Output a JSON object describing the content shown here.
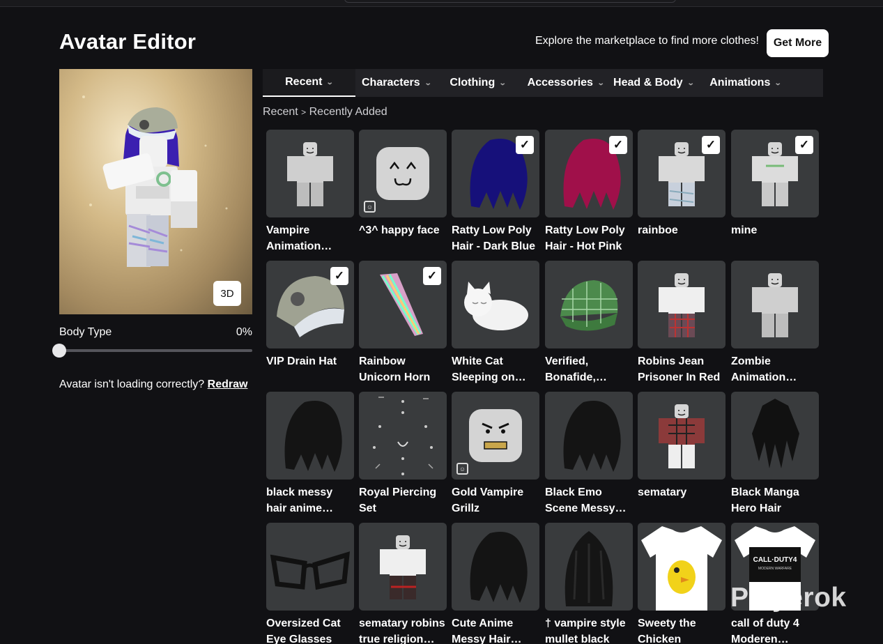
{
  "header": {
    "title": "Avatar Editor",
    "explore_text": "Explore the marketplace to find more clothes!",
    "get_more_label": "Get More"
  },
  "preview": {
    "view_toggle_label": "3D",
    "body_type_label": "Body Type",
    "body_type_value": "0%",
    "body_type_fraction": 0,
    "loading_text": "Avatar isn't loading correctly?",
    "redraw_label": "Redraw"
  },
  "tabs": [
    {
      "label": "Recent",
      "active": true
    },
    {
      "label": "Characters"
    },
    {
      "label": "Clothing"
    },
    {
      "label": "Accessories"
    },
    {
      "label": "Head & Body"
    },
    {
      "label": "Animations"
    }
  ],
  "breadcrumb": {
    "root": "Recent",
    "separator": ">",
    "current": "Recently Added"
  },
  "items": [
    {
      "name": "Vampire Animation…",
      "thumb": "figure-grey",
      "checked": false
    },
    {
      "name": "^3^ happy face",
      "thumb": "face-happy",
      "checked": false,
      "badge": "face-icon"
    },
    {
      "name": "Ratty Low Poly Hair - Dark Blue",
      "thumb": "hair-blue",
      "checked": true
    },
    {
      "name": "Ratty Low Poly Hair - Hot Pink",
      "thumb": "hair-pink",
      "checked": true
    },
    {
      "name": "rainboe",
      "thumb": "figure-pants",
      "checked": true
    },
    {
      "name": "mine",
      "thumb": "figure-shirt",
      "checked": true
    },
    {
      "name": "VIP Drain Hat",
      "thumb": "cap",
      "checked": true
    },
    {
      "name": "Rainbow Unicorn Horn",
      "thumb": "horn",
      "checked": true
    },
    {
      "name": "White Cat Sleeping on Lef…",
      "thumb": "cat",
      "checked": false
    },
    {
      "name": "Verified, Bonafide,…",
      "thumb": "green-cap",
      "checked": false
    },
    {
      "name": "Robins Jean Prisoner In Red",
      "thumb": "figure-plaid",
      "checked": false
    },
    {
      "name": "Zombie Animation…",
      "thumb": "figure-grey",
      "checked": false
    },
    {
      "name": "black messy hair anime season 10",
      "thumb": "hair-black",
      "checked": false
    },
    {
      "name": "Royal Piercing Set",
      "thumb": "piercings",
      "checked": false
    },
    {
      "name": "Gold Vampire Grillz",
      "thumb": "face-angry",
      "checked": false,
      "badge": "face-icon"
    },
    {
      "name": "Black Emo Scene Messy…",
      "thumb": "hair-black",
      "checked": false
    },
    {
      "name": "sematary",
      "thumb": "figure-redshirt",
      "checked": false
    },
    {
      "name": "Black Manga Hero Hair",
      "thumb": "hair-spiky",
      "checked": false
    },
    {
      "name": "Oversized Cat Eye Glasses",
      "thumb": "glasses",
      "checked": false
    },
    {
      "name": "sematary robins true religion…",
      "thumb": "figure-darkpants",
      "checked": false
    },
    {
      "name": "Cute Anime Messy Hair…",
      "thumb": "hair-black",
      "checked": false
    },
    {
      "name": "† vampire style mullet black",
      "thumb": "hair-long",
      "checked": false
    },
    {
      "name": "Sweety the Chicken",
      "thumb": "tshirt-chick",
      "checked": false
    },
    {
      "name": "call of duty 4 Moderen…",
      "thumb": "tshirt-cod",
      "checked": false
    }
  ],
  "cod_logo_text": "CALL·DUTY4",
  "cod_logo_sub": "MODERN WARFARE",
  "watermark": "Playerok",
  "colors": {
    "background": "#111114",
    "tile": "#393b3d",
    "tab_bar": "#222226"
  }
}
